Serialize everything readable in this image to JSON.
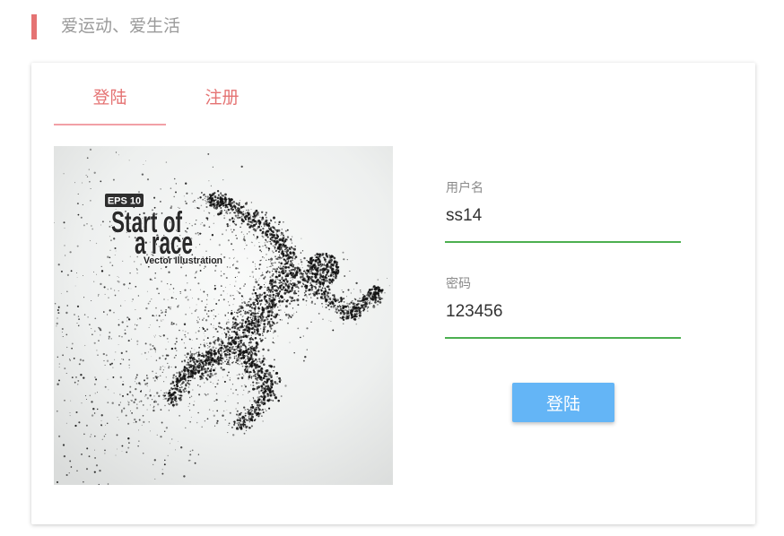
{
  "header": {
    "slogan": "爱运动、爱生活"
  },
  "tabs": [
    {
      "label": "登陆",
      "active": true
    },
    {
      "label": "注册",
      "active": false
    }
  ],
  "hero": {
    "badge": "EPS 10",
    "title_line1": "Start of",
    "title_line2": "a race",
    "caption": "Vector Illustration"
  },
  "form": {
    "username": {
      "label": "用户名",
      "value": "ss14"
    },
    "password": {
      "label": "密码",
      "value": "123456"
    },
    "submit_label": "登陆"
  },
  "theme": {
    "accent": "#e57373",
    "tab_underline": "#f2a0a6",
    "input_underline": "#4caf50",
    "button": "#64b5f6"
  }
}
